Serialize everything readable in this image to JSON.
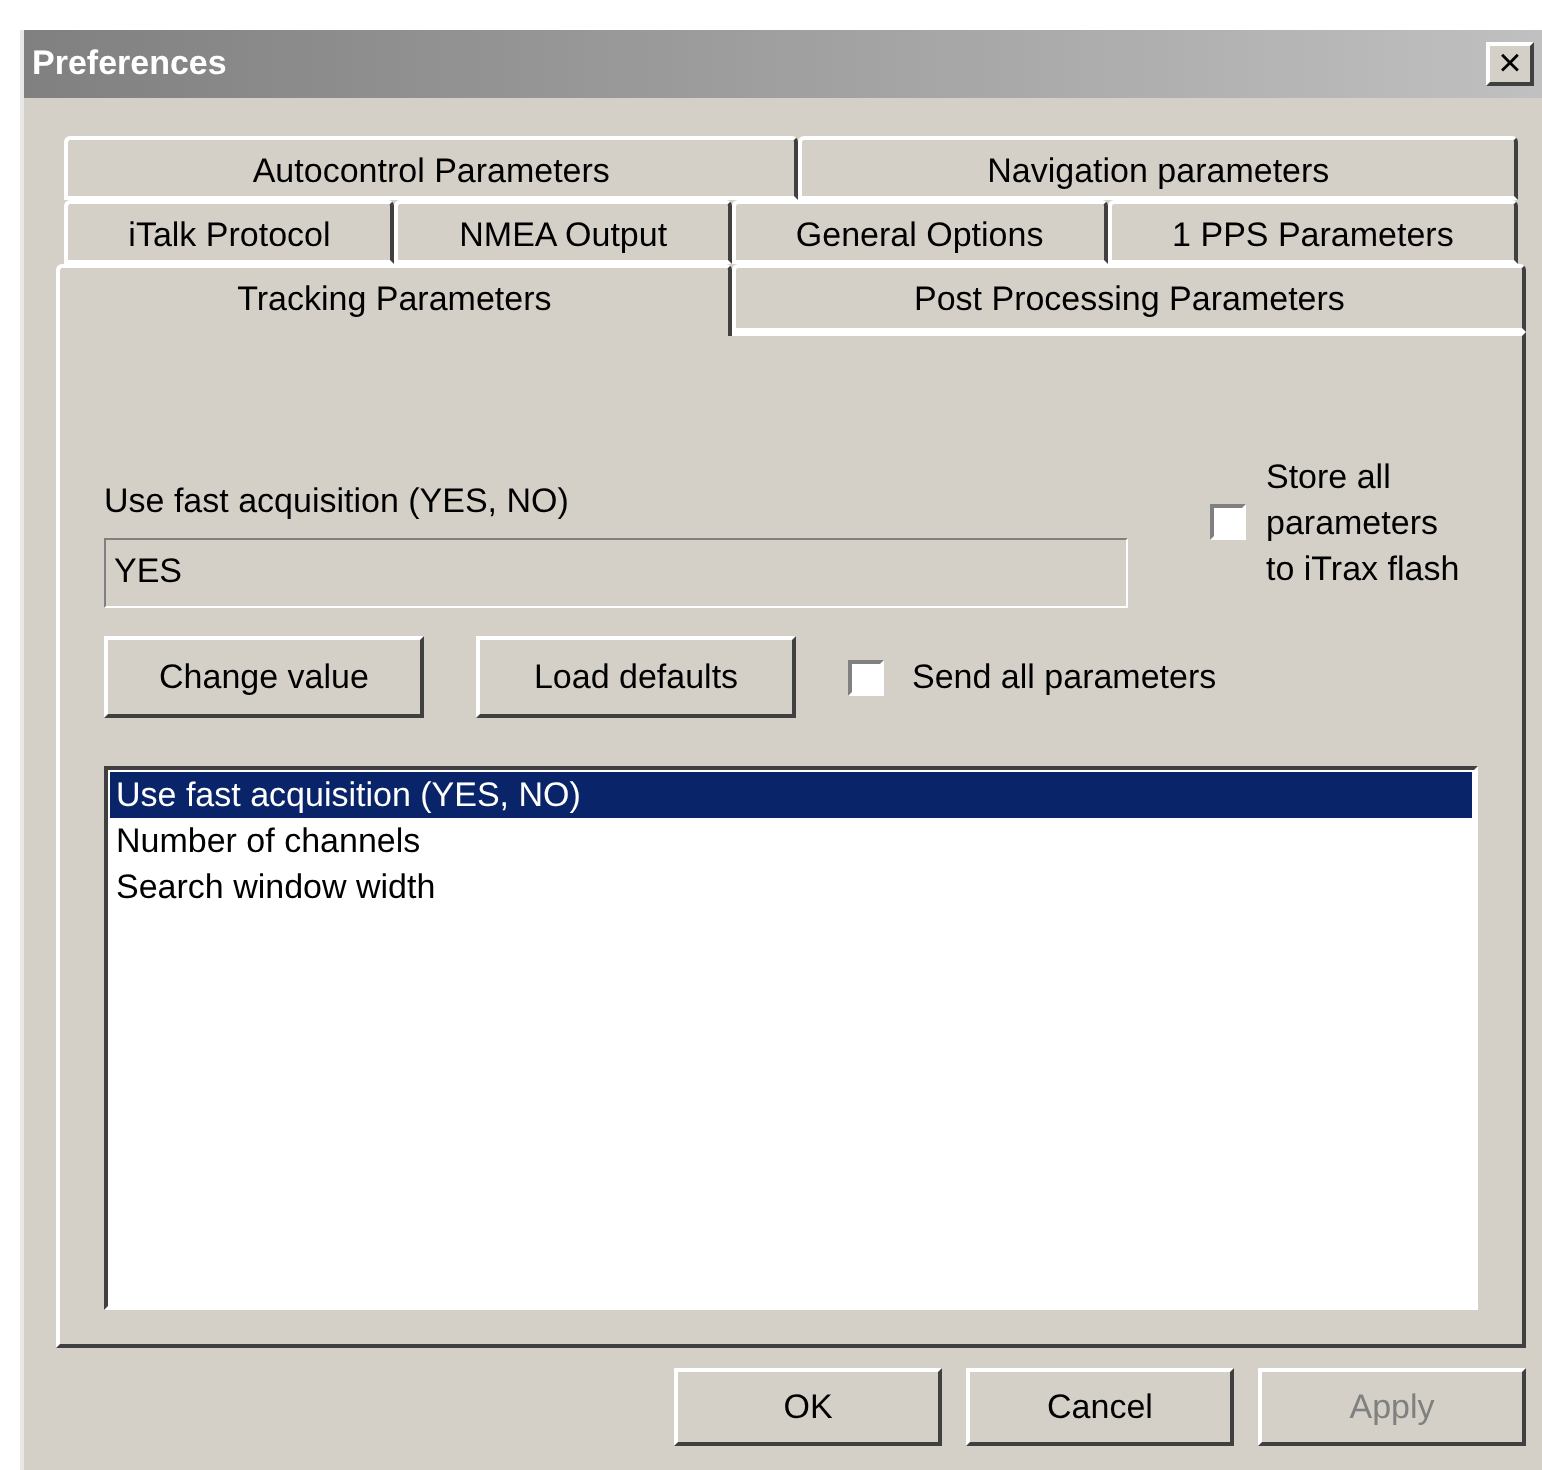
{
  "window": {
    "title": "Preferences",
    "close": "×"
  },
  "tab_rows": [
    [
      {
        "label": "Autocontrol Parameters",
        "selected": false
      },
      {
        "label": "Navigation parameters",
        "selected": false
      }
    ],
    [
      {
        "label": "iTalk Protocol",
        "selected": false
      },
      {
        "label": "NMEA Output",
        "selected": false
      },
      {
        "label": "General Options",
        "selected": false
      },
      {
        "label": "1 PPS Parameters",
        "selected": false
      }
    ],
    [
      {
        "label": "Tracking Parameters",
        "selected": true
      },
      {
        "label": "Post Processing Parameters",
        "selected": false
      }
    ]
  ],
  "parameter": {
    "label": "Use fast acquisition (YES, NO)",
    "value": "YES"
  },
  "store_checkbox": {
    "label": "Store all parameters to iTrax flash",
    "checked": false
  },
  "buttons": [
    "Change value",
    "Load defaults"
  ],
  "send_checkbox": {
    "label": "Send all parameters",
    "checked": false
  },
  "list": [
    {
      "label": "Use fast acquisition (YES, NO)",
      "selected": true
    },
    {
      "label": "Number of channels",
      "selected": false
    },
    {
      "label": "Search window width",
      "selected": false
    }
  ],
  "dialog_buttons": [
    {
      "label": "OK",
      "disabled": false
    },
    {
      "label": "Cancel",
      "disabled": false
    },
    {
      "label": "Apply",
      "disabled": true
    }
  ]
}
